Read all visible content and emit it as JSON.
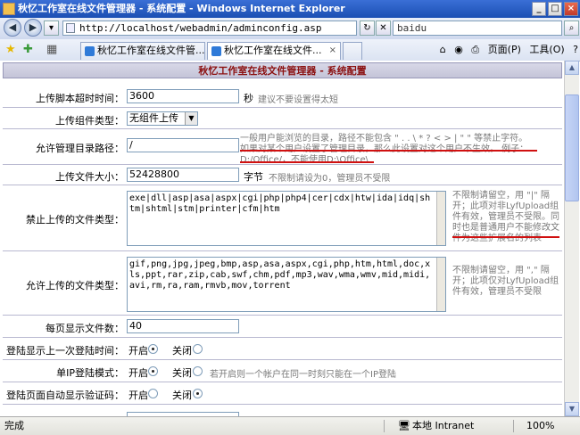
{
  "window": {
    "title": "秋忆工作室在线文件管理器 - 系统配置 - Windows Internet Explorer"
  },
  "nav": {
    "address": "http://localhost/webadmin/adminconfig.asp",
    "search_value": "baidu"
  },
  "tabs": [
    {
      "label": "秋忆工作室在线文件管..."
    },
    {
      "label": "秋忆工作室在线文件..."
    }
  ],
  "commands": {
    "page": "页面(P)",
    "tools": "工具(O)"
  },
  "header": {
    "title": "秋忆工作室在线文件管理器 - 系统配置"
  },
  "form": {
    "timeout_label": "上传脚本超时时间：",
    "timeout_value": "3600",
    "timeout_unit": "秒",
    "timeout_hint": "建议不要设置得太短",
    "component_label": "上传组件类型：",
    "component_value": "无组件上传类",
    "dir_label": "允许管理目录路径：",
    "dir_value": "/",
    "dir_hint1": "一般用户能浏览的目录，路径不能包含 \" . . \\ * ? < > | \" \" 等禁止字符。",
    "dir_hint2": "如果对某个用户设置了管理目录，那么此设置对这个用户不生效。 例子：",
    "dir_hint3": "D:/Office/，不能使用D:\\Office\\",
    "size_label": "上传文件大小：",
    "size_value": "52428800",
    "size_unit": "字节",
    "size_hint": "不限制请设为0，管理员不受限",
    "forbid_label": "禁止上传的文件类型：",
    "forbid_value": "exe|dll|asp|asa|aspx|cgi|php|php4|cer|cdx|htw|ida|idq|shtm|shtml|stm|printer|cfm|htm",
    "forbid_hint": "不限制请留空，用 \"|\" 隔开；此项对非LyfUpload组件有效，管理员不受限。同时也是普通用户不能修改文件为这些扩展名的列表",
    "allow_label": "允许上传的文件类型：",
    "allow_value": "gif,png,jpg,jpeg,bmp,asp,asa,aspx,cgi,php,htm,html,doc,xls,ppt,rar,zip,cab,swf,chm,pdf,mp3,wav,wma,wmv,mid,midi,avi,rm,ra,ram,rmvb,mov,torrent",
    "allow_hint": "不限制请留空，用 \",\" 隔开；此项仅对LyfUpload组件有效，管理员不受限",
    "perpage_label": "每页显示文件数：",
    "perpage_value": "40",
    "lastlogin_label": "登陆显示上一次登陆时间：",
    "on_label": "开启",
    "off_label": "关闭",
    "singleip_label": "单IP登陆模式：",
    "singleip_hint": "若开启则一个帐户在同一时刻只能在一个IP登陆",
    "captcha_label": "登陆页面自动显示验证码："
  },
  "status": {
    "text": "完成",
    "zone": "本地 Intranet",
    "zoom": "100%"
  }
}
